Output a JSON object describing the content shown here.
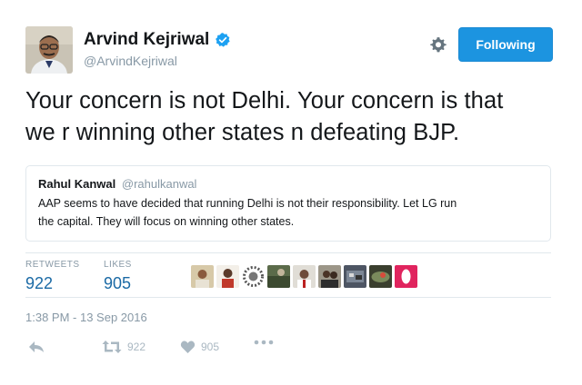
{
  "author": {
    "name": "Arvind Kejriwal",
    "handle": "@ArvindKejriwal",
    "verified": true
  },
  "header": {
    "follow_label": "Following"
  },
  "tweet": {
    "line1": "Your concern is not Delhi. Your concern is that",
    "line2": "we r winning other states n defeating BJP."
  },
  "quoted": {
    "name": "Rahul Kanwal",
    "handle": "@rahulkanwal",
    "line1": "AAP seems to have decided that running Delhi is not their responsibility. Let LG run",
    "line2": "the capital. They will focus on winning other states."
  },
  "stats": {
    "retweets_label": "RETWEETS",
    "retweets_value": "922",
    "likes_label": "LIKES",
    "likes_value": "905"
  },
  "timestamp": "1:38 PM - 13 Sep 2016",
  "actions": {
    "retweet_count": "922",
    "like_count": "905"
  },
  "colors": {
    "accent": "#1c94e0",
    "link": "#1b6aa5",
    "muted": "#8899a6",
    "like_icon": "#aab8c2"
  }
}
